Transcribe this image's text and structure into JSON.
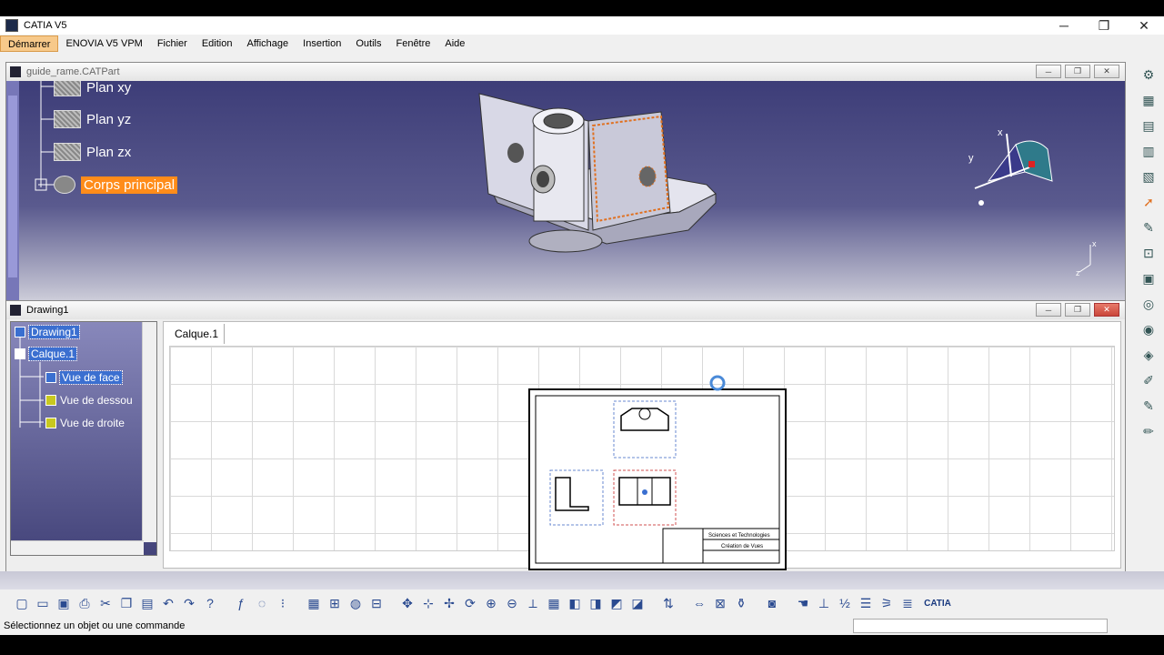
{
  "window": {
    "title": "CATIA V5",
    "minimize": "─",
    "maximize": "❐",
    "close": "✕"
  },
  "menu": [
    "Démarrer",
    "ENOVIA V5 VPM",
    "Fichier",
    "Edition",
    "Affichage",
    "Insertion",
    "Outils",
    "Fenêtre",
    "Aide"
  ],
  "part_window": {
    "title": "guide_rame.CATPart",
    "tree": [
      "Plan xy",
      "Plan yz",
      "Plan zx",
      "Corps principal"
    ],
    "compass_x": "x",
    "compass_y": "y",
    "axis_x": "x",
    "axis_z": "z"
  },
  "drawing_window": {
    "title": "Drawing1",
    "tree": [
      "Drawing1",
      "Calque.1",
      "Vue de face",
      "Vue de dessou",
      "Vue de droite"
    ],
    "tab": "Calque.1",
    "title_block": [
      "Sciences et Technologies",
      "Création de Vues"
    ]
  },
  "icons": {
    "right": [
      "gear-icon",
      "select-icon",
      "sketch-icon",
      "drawing-icon",
      "view-icon",
      "dim-icon",
      "anno-icon",
      "dress-icon",
      "gen-icon",
      "pencil-icon",
      "arrow-icon",
      "text-icon"
    ],
    "toolbar": [
      "new-icon",
      "open-icon",
      "save-icon",
      "print-icon",
      "cut-icon",
      "copy-icon",
      "paste-icon",
      "undo-icon",
      "redo-icon",
      "help-icon",
      "fx-icon",
      "comment-icon",
      "param-icon",
      "grid-icon",
      "tree-icon",
      "analysis-icon",
      "catalog-icon",
      "fit-icon",
      "pan-icon",
      "move-icon",
      "rotate-icon",
      "zoom-in-icon",
      "zoom-out-icon",
      "normal-icon",
      "views-icon",
      "render-icon",
      "hide-icon",
      "swap-icon",
      "snapshot-icon",
      "update-icon",
      "measure-icon",
      "mass-icon",
      "camera-icon",
      "refresh-icon",
      "hand-icon",
      "axis-icon",
      "ratio-icon",
      "layer-icon",
      "filter-icon",
      "list-icon",
      "catia-logo"
    ]
  },
  "status": {
    "message": "Sélectionnez un objet ou une commande",
    "command": ""
  },
  "brand": "CATIA"
}
